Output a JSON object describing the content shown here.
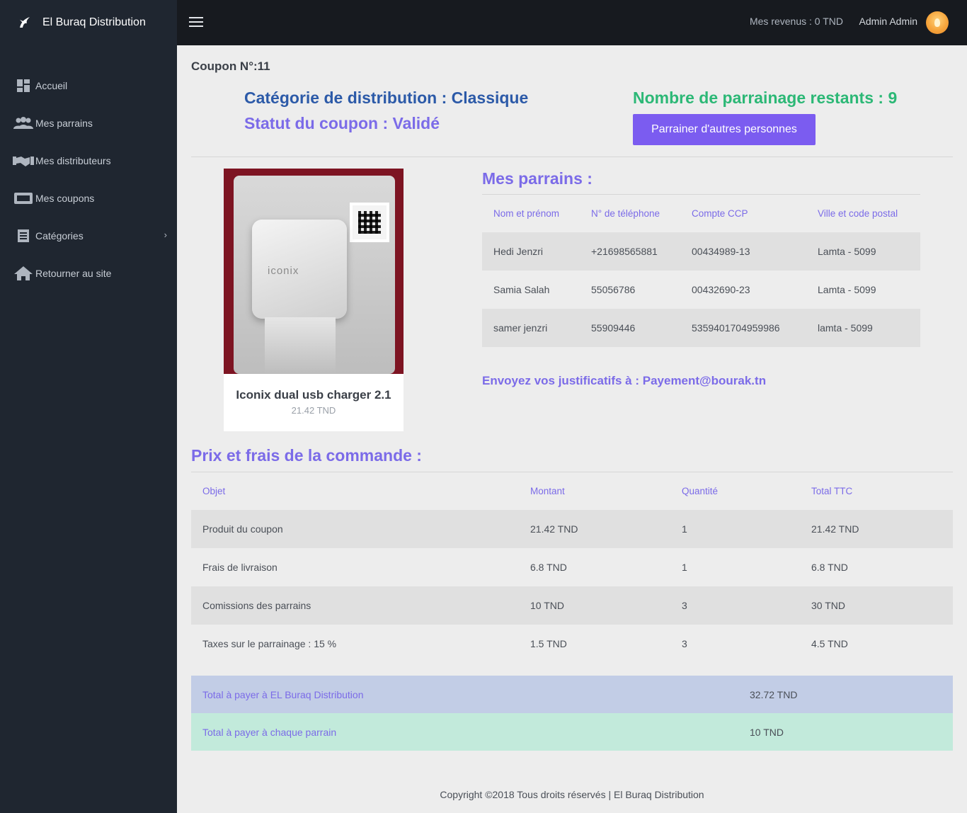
{
  "app": {
    "brand": "El Buraq Distribution"
  },
  "sidebar": {
    "items": [
      {
        "label": "Accueil",
        "icon": "dashboard-icon"
      },
      {
        "label": "Mes parrains",
        "icon": "users-icon"
      },
      {
        "label": "Mes distributeurs",
        "icon": "handshake-icon"
      },
      {
        "label": "Mes coupons",
        "icon": "ticket-icon"
      },
      {
        "label": "Catégories",
        "icon": "list-icon",
        "has_children": true
      },
      {
        "label": "Retourner au site",
        "icon": "home-icon"
      }
    ]
  },
  "topbar": {
    "revenue": "Mes revenus : 0 TND",
    "user": "Admin Admin"
  },
  "coupon": {
    "number": "Coupon N°:11",
    "category": "Catégorie de distribution : Classique",
    "status": "Statut du coupon : Validé",
    "remaining": "Nombre de parrainage restants : 9",
    "sponsor_button": "Parrainer d'autres personnes"
  },
  "product": {
    "name": "Iconix dual usb charger 2.1",
    "price": "21.42 TND",
    "image_brand": "iconix"
  },
  "parrains": {
    "title": "Mes parrains :",
    "columns": [
      "Nom et prénom",
      "N° de téléphone",
      "Compte CCP",
      "Ville et code postal"
    ],
    "rows": [
      [
        "Hedi Jenzri",
        "+21698565881",
        "00434989-13",
        "Lamta - 5099"
      ],
      [
        "Samia Salah",
        "55056786",
        "00432690-23",
        "Lamta - 5099"
      ],
      [
        "samer jenzri",
        "55909446",
        "5359401704959986",
        "lamta - 5099"
      ]
    ],
    "justificatifs": "Envoyez vos justificatifs à : Payement@bourak.tn"
  },
  "order": {
    "title": "Prix et frais de la commande :",
    "columns": [
      "Objet",
      "Montant",
      "Quantité",
      "Total TTC"
    ],
    "rows": [
      [
        "Produit du coupon",
        "21.42 TND",
        "1",
        "21.42 TND"
      ],
      [
        "Frais de livraison",
        "6.8 TND",
        "1",
        "6.8 TND"
      ],
      [
        "Comissions des parrains",
        "10 TND",
        "3",
        "30 TND"
      ],
      [
        "Taxes sur le parrainage : 15 %",
        "1.5 TND",
        "3",
        "4.5 TND"
      ]
    ],
    "totals": [
      {
        "label": "Total à payer à EL Buraq Distribution",
        "value": "32.72 TND"
      },
      {
        "label": "Total à payer à chaque parrain",
        "value": "10 TND"
      }
    ]
  },
  "footer": {
    "text": "Copyright ©2018 Tous droits réservés | El Buraq Distribution"
  }
}
